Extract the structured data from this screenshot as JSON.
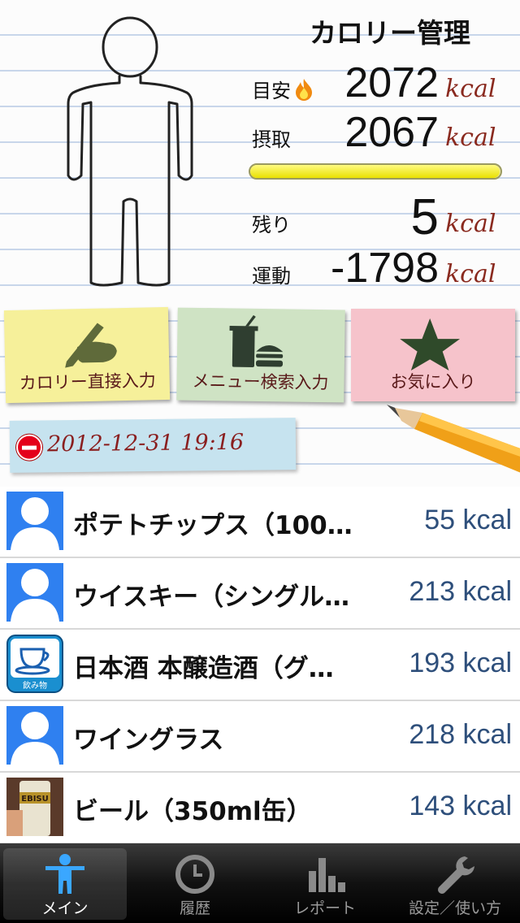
{
  "header": {
    "title": "カロリー管理"
  },
  "stats": {
    "target": {
      "label": "目安",
      "value": "2072",
      "unit": "kcal"
    },
    "intake": {
      "label": "摂取",
      "value": "2067",
      "unit": "kcal"
    },
    "progress": 0.998,
    "remaining": {
      "label": "残り",
      "value": "5",
      "unit": "kcal"
    },
    "exercise": {
      "label": "運動",
      "value": "-1798",
      "unit": "kcal"
    }
  },
  "actions": {
    "direct": "カロリー直接入力",
    "menu": "メニュー検索入力",
    "favorites": "お気に入り"
  },
  "date": "2012-12-31 19:16",
  "items": [
    {
      "name": "ポテトチップス（100…",
      "kcal": "55 kcal",
      "icon": "person-icon"
    },
    {
      "name": "ウイスキー（シングル…",
      "kcal": "213 kcal",
      "icon": "person-icon"
    },
    {
      "name": "日本酒 本醸造酒（グ…",
      "kcal": "193 kcal",
      "icon": "drink-cup-icon",
      "icon_label": "飲み物"
    },
    {
      "name": "ワイングラス",
      "kcal": "218 kcal",
      "icon": "person-icon"
    },
    {
      "name": "ビール（350ml缶）",
      "kcal": "143 kcal",
      "icon": "beer-can-photo",
      "icon_label": "EBISU"
    }
  ],
  "tabs": {
    "main": "メイン",
    "history": "履歴",
    "report": "レポート",
    "settings": "設定／使い方"
  },
  "colors": {
    "unit": "#8a2a1f",
    "kcal_list": "#2e4f7b",
    "placeholder_blue": "#2f80f0"
  }
}
